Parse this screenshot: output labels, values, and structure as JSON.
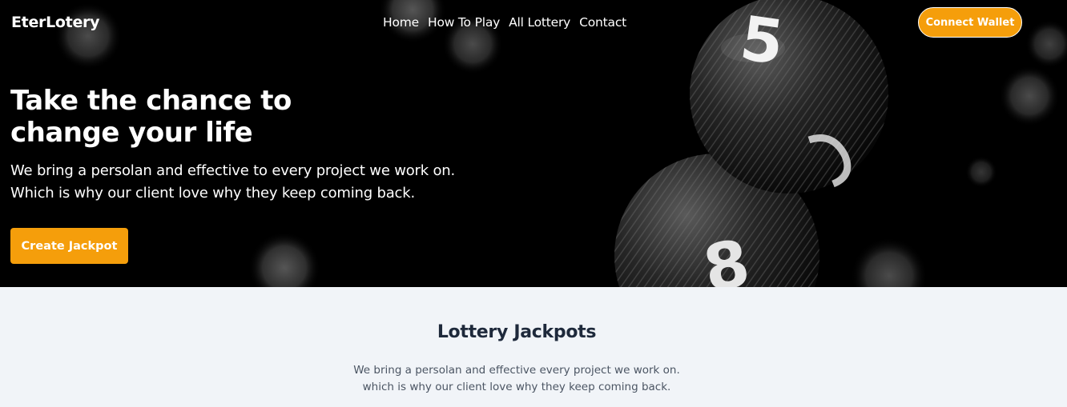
{
  "header": {
    "brand": "EterLotery",
    "nav": [
      "Home",
      "How To Play",
      "All Lottery",
      "Contact"
    ],
    "connect_wallet": "Connect Wallet"
  },
  "hero": {
    "title": "Take the chance to change your life",
    "subtitle_line1": "We bring a persolan and effective to every project we work on.",
    "subtitle_line2": "Which is why our client love why they keep coming back.",
    "cta": "Create Jackpot",
    "background": "lottery-balls-image",
    "ball_digits": [
      "5",
      "8"
    ]
  },
  "jackpots": {
    "title": "Lottery Jackpots",
    "desc_line1": "We bring a persolan and effective every project we work on.",
    "desc_line2": "which is why our client love why they keep coming back."
  },
  "colors": {
    "accent": "#f59e0b",
    "hero_bg": "#000000",
    "section_bg": "#f1f4f8",
    "heading": "#1e293b"
  }
}
